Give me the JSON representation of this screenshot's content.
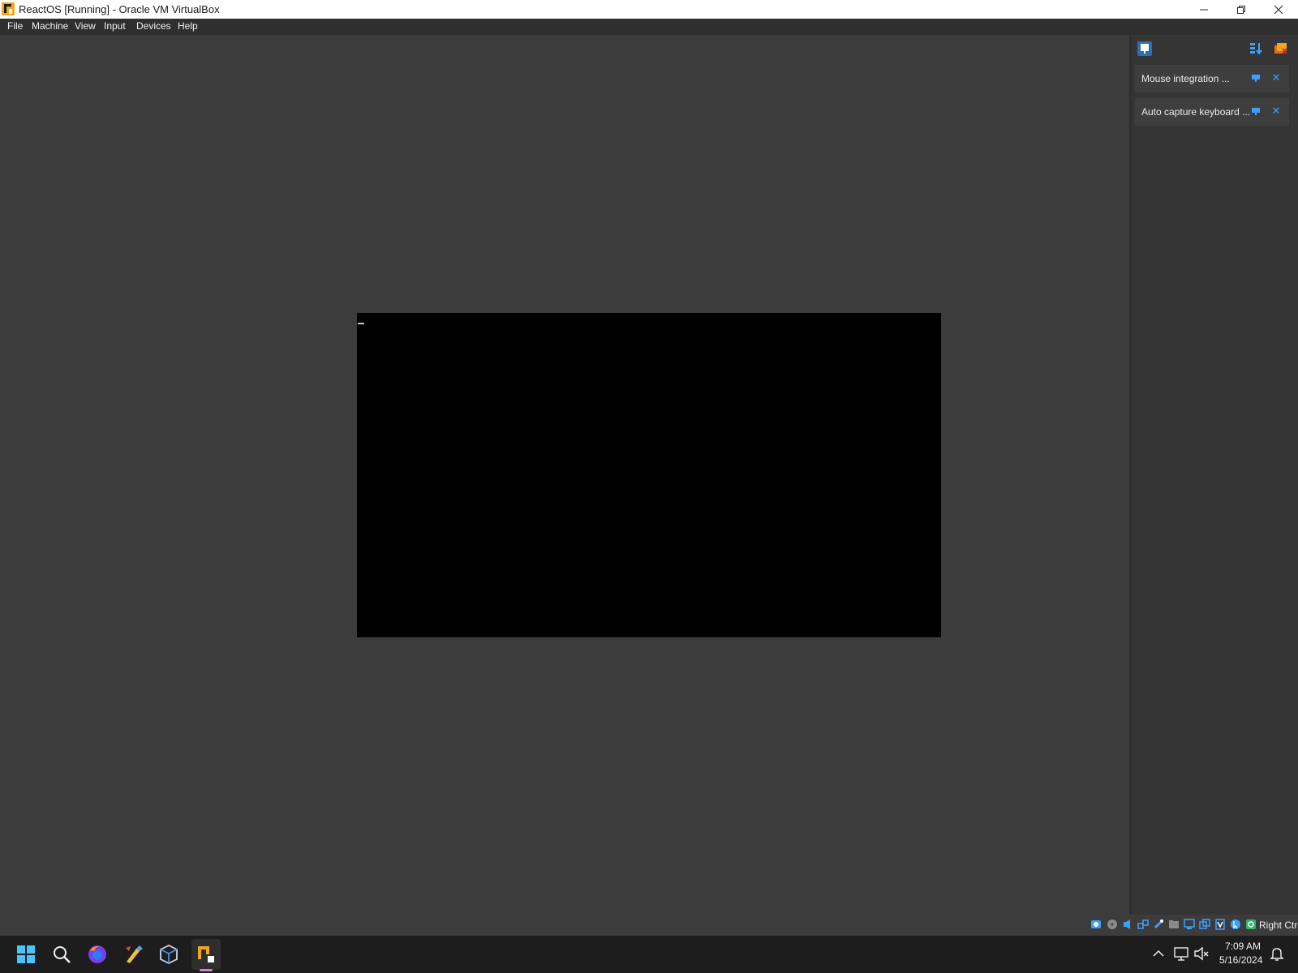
{
  "window": {
    "title": "ReactOS [Running] - Oracle VM VirtualBox",
    "app_icon": "virtualbox-vm-icon",
    "controls": [
      "minimize-icon",
      "restore-icon",
      "close-icon"
    ]
  },
  "menubar": {
    "items": [
      {
        "label": "File"
      },
      {
        "label": "Machine"
      },
      {
        "label": "View"
      },
      {
        "label": "Input"
      },
      {
        "label": "Devices"
      },
      {
        "label": "Help"
      }
    ]
  },
  "vm_display": {
    "background": "#000000",
    "cursor_glyph": "_"
  },
  "notification_center": {
    "header_icons": [
      "notification-center-icon",
      "sort-order-icon",
      "dismiss-all-icon"
    ],
    "notifications": [
      {
        "text": "Mouse integration ..."
      },
      {
        "text": "Auto capture keyboard ..."
      }
    ],
    "accent": "#3aa0ff"
  },
  "statusbar": {
    "icons": [
      "hard-disk-icon",
      "optical-disk-icon",
      "audio-icon",
      "network-icon",
      "usb-icon",
      "shared-folders-icon",
      "display-icon",
      "video-capture-icon",
      "vt-x-icon",
      "mouse-integration-icon",
      "keyboard-capture-icon"
    ],
    "host_key": "Right Ctrl"
  },
  "taskbar": {
    "apps": [
      "start-icon",
      "search-icon",
      "firefox-icon",
      "paint-tool-icon",
      "virtualbox-icon",
      "virtualbox-vm-icon"
    ],
    "tray_icons": [
      "chevron-up-icon",
      "network-icon",
      "volume-muted-icon",
      "notification-bell-icon"
    ],
    "time": "7:09 AM",
    "date": "5/16/2024",
    "active_indicator_color": "#d37fd8"
  }
}
